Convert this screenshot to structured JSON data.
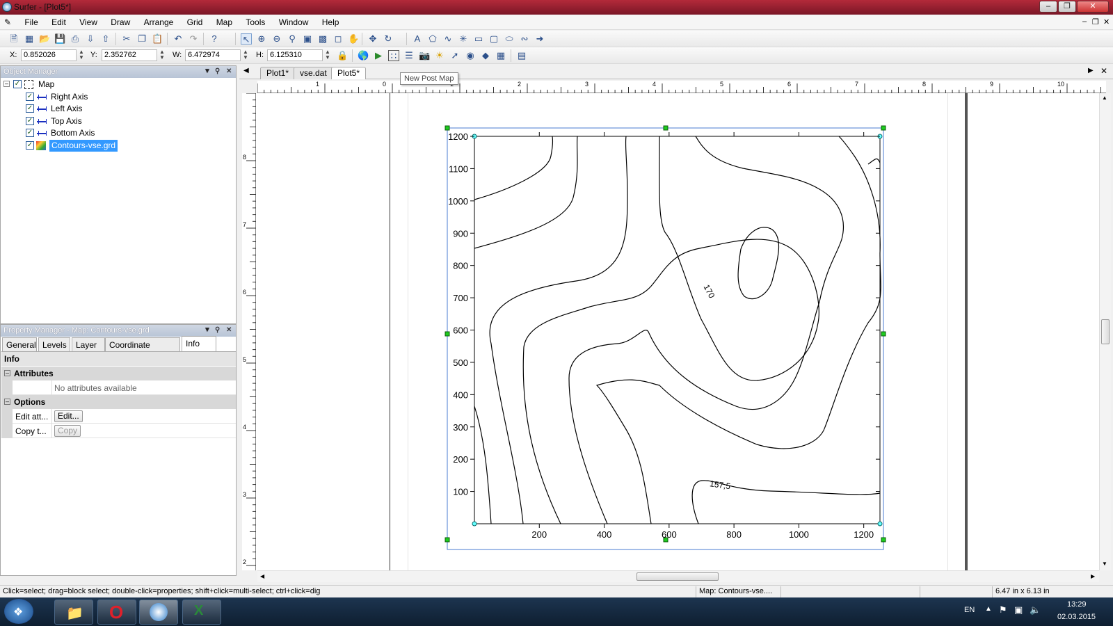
{
  "window": {
    "title": "Surfer - [Plot5*]"
  },
  "menu": [
    "File",
    "Edit",
    "View",
    "Draw",
    "Arrange",
    "Grid",
    "Map",
    "Tools",
    "Window",
    "Help"
  ],
  "coords": {
    "x_label": "X:",
    "x": "0.852026",
    "y_label": "Y:",
    "y": "2.352762",
    "w_label": "W:",
    "w": "6.472974",
    "h_label": "H:",
    "h": "6.125310"
  },
  "object_manager": {
    "title": "Object Manager",
    "root": "Map",
    "items": [
      "Right Axis",
      "Left Axis",
      "Top Axis",
      "Bottom Axis",
      "Contours-vse.grd"
    ]
  },
  "property_manager": {
    "title": "Property Manager - Map: Contours-vse.grd",
    "tabs": [
      "General",
      "Levels",
      "Layer",
      "Coordinate System",
      "Info"
    ],
    "section_info": "Info",
    "section_attributes": "Attributes",
    "no_attributes": "No attributes available",
    "section_options": "Options",
    "row1_label": "Edit att...",
    "row1_button": "Edit...",
    "row2_label": "Copy t...",
    "row2_button": "Copy"
  },
  "doc_tabs": [
    "Plot1*",
    "vse.dat",
    "Plot5*"
  ],
  "tooltip": "New Post Map",
  "hruler_labels": [
    "1",
    "0",
    "1",
    "2",
    "3",
    "4",
    "5",
    "6",
    "7",
    "8",
    "9",
    "10"
  ],
  "vruler_labels": [
    "8",
    "7",
    "6",
    "5",
    "4",
    "3",
    "2"
  ],
  "map": {
    "y_ticks": [
      "1200",
      "1100",
      "1000",
      "900",
      "800",
      "700",
      "600",
      "500",
      "400",
      "300",
      "200",
      "100"
    ],
    "x_ticks": [
      "200",
      "400",
      "600",
      "800",
      "1000",
      "1200"
    ],
    "contour_labels": [
      "170",
      "157,5"
    ]
  },
  "status": {
    "hint": "Click=select; drag=block select; double-click=properties; shift+click=multi-select; ctrl+click=dig",
    "object": "Map: Contours-vse....",
    "size": "6.47 in x 6.13 in"
  },
  "tray": {
    "lang": "EN",
    "time": "13:29",
    "date": "02.03.2015"
  }
}
